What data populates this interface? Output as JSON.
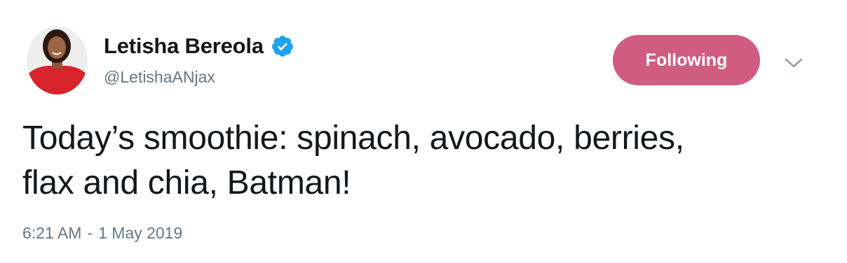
{
  "author": {
    "display_name": "Letisha Bereola",
    "handle": "@LetishaANjax",
    "verified": true,
    "avatar_icon": "profile-photo"
  },
  "follow_button": {
    "label": "Following",
    "color": "#d15c82"
  },
  "menu": {
    "icon": "chevron-down-icon"
  },
  "tweet": {
    "text_line_1": "Today’s smoothie: spinach, avocado, berries,",
    "text_line_2": "flax and chia, Batman!"
  },
  "meta": {
    "time": "6:21 AM",
    "separator": "-",
    "date": "1 May 2019"
  },
  "colors": {
    "verified_blue": "#1da1f2",
    "secondary_text": "#657786",
    "primary_text": "#14171a"
  }
}
